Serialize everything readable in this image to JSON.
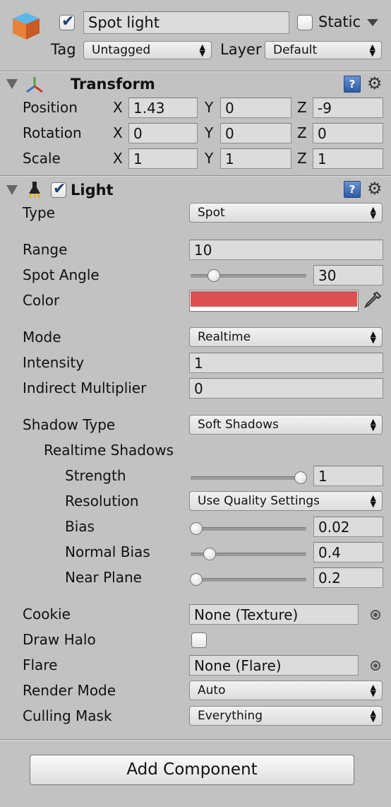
{
  "header": {
    "object_name": "Spot light",
    "static_label": "Static",
    "tag_label": "Tag",
    "tag_value": "Untagged",
    "layer_label": "Layer",
    "layer_value": "Default",
    "active": true,
    "static": false
  },
  "transform": {
    "title": "Transform",
    "rows": [
      {
        "label": "Position",
        "x": "1.43",
        "y": "0",
        "z": "-9"
      },
      {
        "label": "Rotation",
        "x": "0",
        "y": "0",
        "z": "0"
      },
      {
        "label": "Scale",
        "x": "1",
        "y": "1",
        "z": "1"
      }
    ],
    "axis_x": "X",
    "axis_y": "Y",
    "axis_z": "Z"
  },
  "light": {
    "title": "Light",
    "enabled": true,
    "type_label": "Type",
    "type_value": "Spot",
    "range_label": "Range",
    "range_value": "10",
    "spot_angle_label": "Spot Angle",
    "spot_angle_value": "30",
    "spot_angle_fraction": 0.17,
    "color_label": "Color",
    "color_value": "#dc5050",
    "mode_label": "Mode",
    "mode_value": "Realtime",
    "intensity_label": "Intensity",
    "intensity_value": "1",
    "indirect_label": "Indirect Multiplier",
    "indirect_value": "0",
    "shadow_type_label": "Shadow Type",
    "shadow_type_value": "Soft Shadows",
    "realtime_shadows_label": "Realtime Shadows",
    "strength_label": "Strength",
    "strength_value": "1",
    "strength_fraction": 1.0,
    "resolution_label": "Resolution",
    "resolution_value": "Use Quality Settings",
    "bias_label": "Bias",
    "bias_value": "0.02",
    "bias_fraction": 0.0,
    "normal_bias_label": "Normal Bias",
    "normal_bias_value": "0.4",
    "normal_bias_fraction": 0.13,
    "near_plane_label": "Near Plane",
    "near_plane_value": "0.2",
    "near_plane_fraction": 0.0,
    "cookie_label": "Cookie",
    "cookie_value": "None (Texture)",
    "draw_halo_label": "Draw Halo",
    "draw_halo": false,
    "flare_label": "Flare",
    "flare_value": "None (Flare)",
    "render_mode_label": "Render Mode",
    "render_mode_value": "Auto",
    "culling_mask_label": "Culling Mask",
    "culling_mask_value": "Everything"
  },
  "add_component_label": "Add Component"
}
